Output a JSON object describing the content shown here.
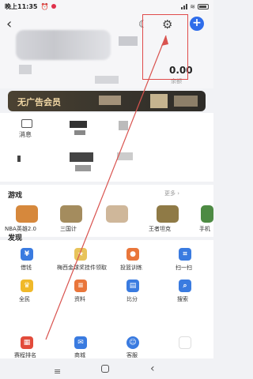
{
  "status_bar": {
    "time": "晚上11:35",
    "alarm_icon": "alarm-icon",
    "notification_icon": "red-dot-icon"
  },
  "header": {
    "back_icon": "back-chevron-icon",
    "night_mode_icon": "moon-icon",
    "settings_icon": "gear-icon",
    "add_icon": "plus-icon",
    "balance_value": "0.00",
    "balance_label": "余额",
    "accent_color": "#2f6dea",
    "highlight_color": "#e04b4b"
  },
  "vip_banner": {
    "text": "无广告会员",
    "bg_color": "#3a352c",
    "text_color": "#f3d9a6"
  },
  "card1": {
    "message_label": "消息"
  },
  "games_section": {
    "title": "游戏",
    "more_label": "更多",
    "items": [
      {
        "label": "NBA英雄2.0",
        "color": "#d6883c"
      },
      {
        "label": "三国计",
        "color": "#a48c5e"
      },
      {
        "label": "",
        "color": "#cfb79a"
      },
      {
        "label": "王者坦克",
        "color": "#8f7a46"
      },
      {
        "label": "手机",
        "color": "#4d8a43"
      }
    ]
  },
  "discover_section": {
    "title": "发现",
    "rows": [
      [
        {
          "label": "借钱",
          "icon": "money-icon",
          "color": "#3a7be0",
          "glyph": "¥"
        },
        {
          "label": "梅西金球奖挂件领取",
          "icon": "gift-icon",
          "color": "#e8c35a",
          "glyph": "★"
        },
        {
          "label": "投篮训练",
          "icon": "basketball-icon",
          "color": "#e9763b",
          "glyph": "●"
        },
        {
          "label": "扫一扫",
          "icon": "scan-icon",
          "color": "#3a7be0",
          "glyph": "⌗"
        }
      ],
      [
        {
          "label": "全民",
          "icon": "trophy-icon",
          "color": "#f0b92a",
          "glyph": "♛"
        },
        {
          "label": "资料",
          "icon": "document-icon",
          "color": "#e9763b",
          "glyph": "≡"
        },
        {
          "label": "比分",
          "icon": "score-icon",
          "color": "#3a7be0",
          "glyph": "▤"
        },
        {
          "label": "搜索",
          "icon": "search-icon",
          "color": "#3a7be0",
          "glyph": "⌕"
        }
      ],
      [
        {
          "label": "赛程排名",
          "icon": "calendar-icon",
          "color": "#e24b3b",
          "glyph": "▦"
        },
        {
          "label": "商城",
          "icon": "shop-icon",
          "color": "#3a7be0",
          "glyph": "✉"
        },
        {
          "label": "客服",
          "icon": "support-icon",
          "color": "#3a7be0",
          "glyph": "☺"
        },
        {
          "label": "",
          "icon": "app-icon",
          "color": "#ffffff",
          "glyph": ""
        }
      ]
    ]
  },
  "nav_bar": {
    "menu_icon": "menu-icon",
    "home_icon": "home-square-icon",
    "back_icon": "back-triangle-icon"
  }
}
